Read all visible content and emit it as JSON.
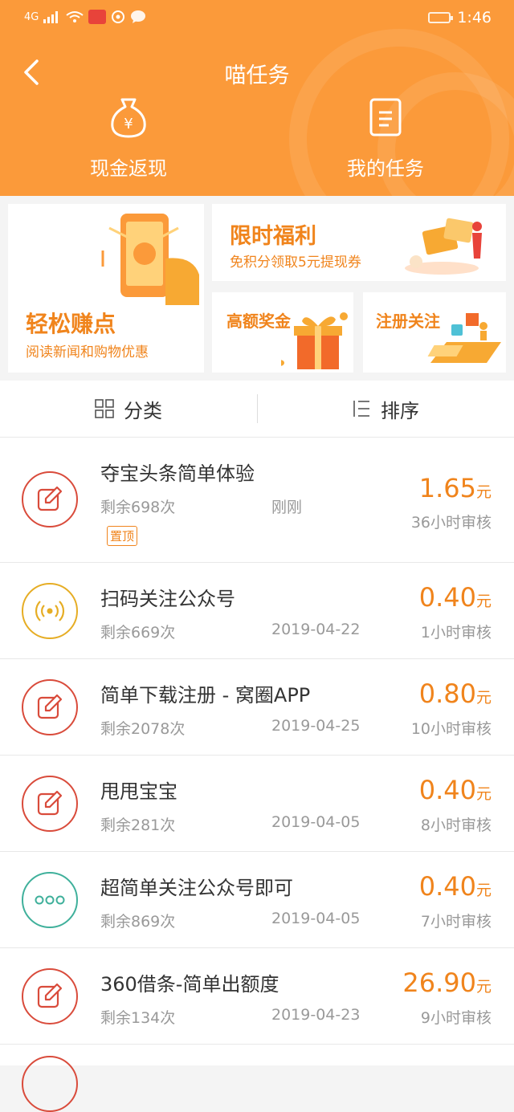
{
  "status_bar": {
    "signal": "4G",
    "time": "1:46"
  },
  "header": {
    "title": "喵任务",
    "back_icon": "back-arrow-icon",
    "tabs": [
      {
        "label": "现金返现",
        "icon": "money-bag-icon"
      },
      {
        "label": "我的任务",
        "icon": "task-list-icon"
      }
    ],
    "color": "#fb9a3a"
  },
  "banners": {
    "easy": {
      "title": "轻松赚点",
      "subtitle": "阅读新闻和购物优惠"
    },
    "limited": {
      "title": "限时福利",
      "subtitle": "免积分领取5元提现券"
    },
    "bonus": {
      "title": "高额奖金"
    },
    "register": {
      "title": "注册关注"
    }
  },
  "filter": {
    "category": "分类",
    "sort": "排序"
  },
  "accent_color": "#f0841c",
  "tasks": [
    {
      "name": "夺宝头条简单体验",
      "remaining": "剩余698次",
      "date": "刚刚",
      "price": "1.65",
      "unit": "元",
      "review": "36小时审核",
      "tag": "置顶",
      "icon": "edit-icon",
      "color": "#d94b3b"
    },
    {
      "name": "扫码关注公众号",
      "remaining": "剩余669次",
      "date": "2019-04-22",
      "price": "0.40",
      "unit": "元",
      "review": "1小时审核",
      "icon": "scan-signal-icon",
      "color": "#e6ad24"
    },
    {
      "name": "简单下载注册 - 窝圈APP",
      "remaining": "剩余2078次",
      "date": "2019-04-25",
      "price": "0.80",
      "unit": "元",
      "review": "10小时审核",
      "icon": "edit-icon",
      "color": "#d94b3b"
    },
    {
      "name": "甩甩宝宝",
      "remaining": "剩余281次",
      "date": "2019-04-05",
      "price": "0.40",
      "unit": "元",
      "review": "8小时审核",
      "icon": "edit-icon",
      "color": "#d94b3b"
    },
    {
      "name": "超简单关注公众号即可",
      "remaining": "剩余869次",
      "date": "2019-04-05",
      "price": "0.40",
      "unit": "元",
      "review": "7小时审核",
      "icon": "more-dots-icon",
      "color": "#3fb09b"
    },
    {
      "name": "360借条-简单出额度",
      "remaining": "剩余134次",
      "date": "2019-04-23",
      "price": "26.90",
      "unit": "元",
      "review": "9小时审核",
      "icon": "edit-icon",
      "color": "#d94b3b"
    }
  ]
}
